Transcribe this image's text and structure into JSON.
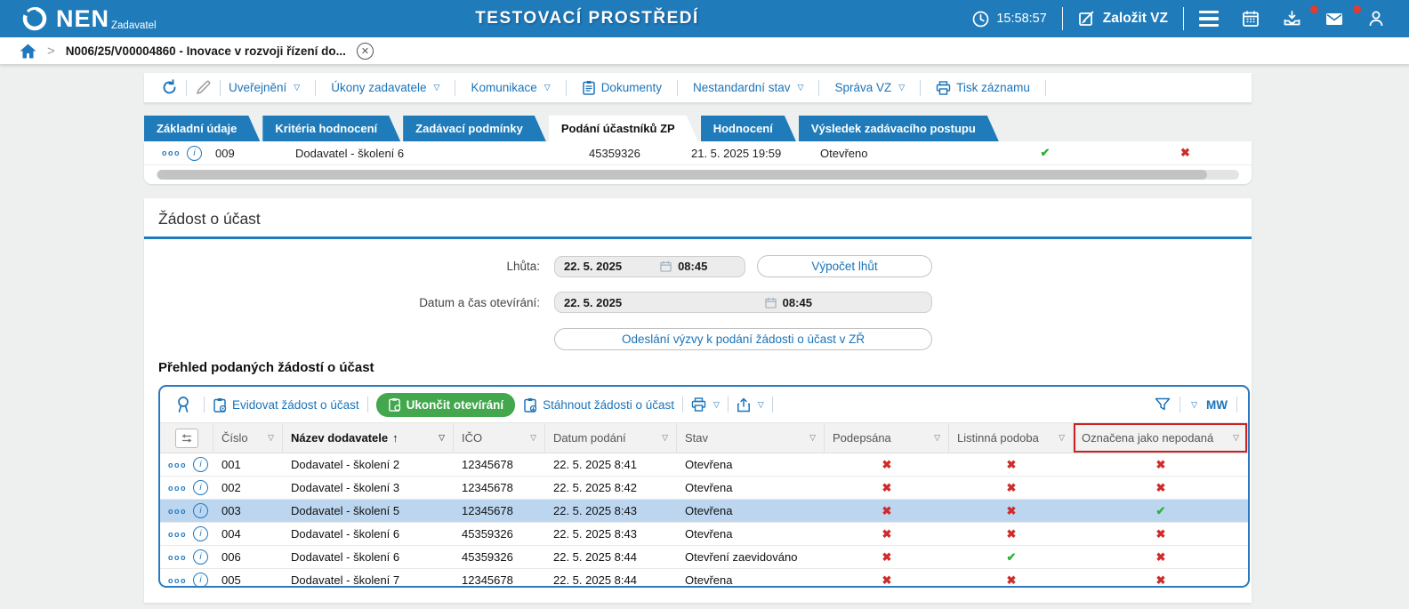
{
  "topbar": {
    "logo": "NEN",
    "logo_sub": "Zadavatel",
    "env_title": "TESTOVACÍ PROSTŘEDÍ",
    "time": "15:58:57",
    "create_vz": "Založit VZ"
  },
  "breadcrumb": {
    "record": "N006/25/V00004860 - Inovace v rozvoji řízení do...",
    "close_glyph": "✕"
  },
  "menu": {
    "items": [
      {
        "label": "Uveřejnění",
        "caret": true,
        "icon": null
      },
      {
        "label": "Úkony zadavatele",
        "caret": true,
        "icon": null
      },
      {
        "label": "Komunikace",
        "caret": true,
        "icon": null
      },
      {
        "label": "Dokumenty",
        "caret": false,
        "icon": "document-icon"
      },
      {
        "label": "Nestandardní stav",
        "caret": true,
        "icon": null
      },
      {
        "label": "Správa VZ",
        "caret": true,
        "icon": null
      },
      {
        "label": "Tisk záznamu",
        "caret": false,
        "icon": "printer-icon"
      }
    ]
  },
  "tabs": [
    {
      "label": "Základní údaje",
      "active": false
    },
    {
      "label": "Kritéria hodnocení",
      "active": false
    },
    {
      "label": "Zadávací podmínky",
      "active": false
    },
    {
      "label": "Podání účastníků ZP",
      "active": true
    },
    {
      "label": "Hodnocení",
      "active": false
    },
    {
      "label": "Výsledek zadávacího postupu",
      "active": false
    }
  ],
  "open_row": {
    "num": "009",
    "name": "Dodavatel - školení 6",
    "ico": "45359326",
    "date": "21. 5. 2025 19:59",
    "stav": "Otevřeno",
    "mark1": "yes",
    "mark2": "no"
  },
  "section": {
    "title": "Žádost o účast",
    "lhuta_label": "Lhůta:",
    "lhuta_date": "22. 5. 2025",
    "lhuta_time": "08:45",
    "vypocet_btn": "Výpočet lhůt",
    "datum_label": "Datum a čas otevírání:",
    "datum_date": "22. 5. 2025",
    "datum_time": "08:45",
    "send_btn": "Odeslání výzvy k podání žádosti o účast v ZŘ"
  },
  "requests": {
    "title": "Přehled podaných žádostí o účast",
    "toolbar": {
      "evidovat": "Evidovat žádost o účast",
      "ukoncit": "Ukončit otevírání",
      "stahnout": "Stáhnout žádosti o účast",
      "filter_initials": "MW"
    },
    "columns": [
      {
        "label": "",
        "type": "settings"
      },
      {
        "label": "Číslo"
      },
      {
        "label": "Název dodavatele",
        "sorted": true
      },
      {
        "label": "IČO"
      },
      {
        "label": "Datum podání"
      },
      {
        "label": "Stav"
      },
      {
        "label": "Podepsána"
      },
      {
        "label": "Listinná podoba"
      },
      {
        "label": "Označena jako nepodaná",
        "flagged": true
      }
    ],
    "rows": [
      {
        "num": "001",
        "name": "Dodavatel - školení 2",
        "ico": "12345678",
        "date": "22. 5. 2025 8:41",
        "stav": "Otevřena",
        "signed": "no",
        "paper": "no",
        "notsub": "no",
        "hl": false
      },
      {
        "num": "002",
        "name": "Dodavatel - školení 3",
        "ico": "12345678",
        "date": "22. 5. 2025 8:42",
        "stav": "Otevřena",
        "signed": "no",
        "paper": "no",
        "notsub": "no",
        "hl": false
      },
      {
        "num": "003",
        "name": "Dodavatel - školení 5",
        "ico": "12345678",
        "date": "22. 5. 2025 8:43",
        "stav": "Otevřena",
        "signed": "no",
        "paper": "no",
        "notsub": "yes",
        "hl": true
      },
      {
        "num": "004",
        "name": "Dodavatel - školení 6",
        "ico": "45359326",
        "date": "22. 5. 2025 8:43",
        "stav": "Otevřena",
        "signed": "no",
        "paper": "no",
        "notsub": "no",
        "hl": false
      },
      {
        "num": "006",
        "name": "Dodavatel - školení 6",
        "ico": "45359326",
        "date": "22. 5. 2025 8:44",
        "stav": "Otevření zaevidováno",
        "signed": "no",
        "paper": "yes",
        "notsub": "no",
        "hl": false
      },
      {
        "num": "005",
        "name": "Dodavatel - školení 7",
        "ico": "12345678",
        "date": "22. 5. 2025 8:44",
        "stav": "Otevřena",
        "signed": "no",
        "paper": "no",
        "notsub": "no",
        "hl": false
      }
    ]
  },
  "colors": {
    "brand_blue": "#1f7bb9",
    "link_blue": "#1b74ba",
    "green": "#43a74d",
    "check_green": "#2eb135",
    "cross_red": "#d02b2b",
    "flag_red": "#cc2222",
    "row_highlight": "#bcd6f0"
  }
}
